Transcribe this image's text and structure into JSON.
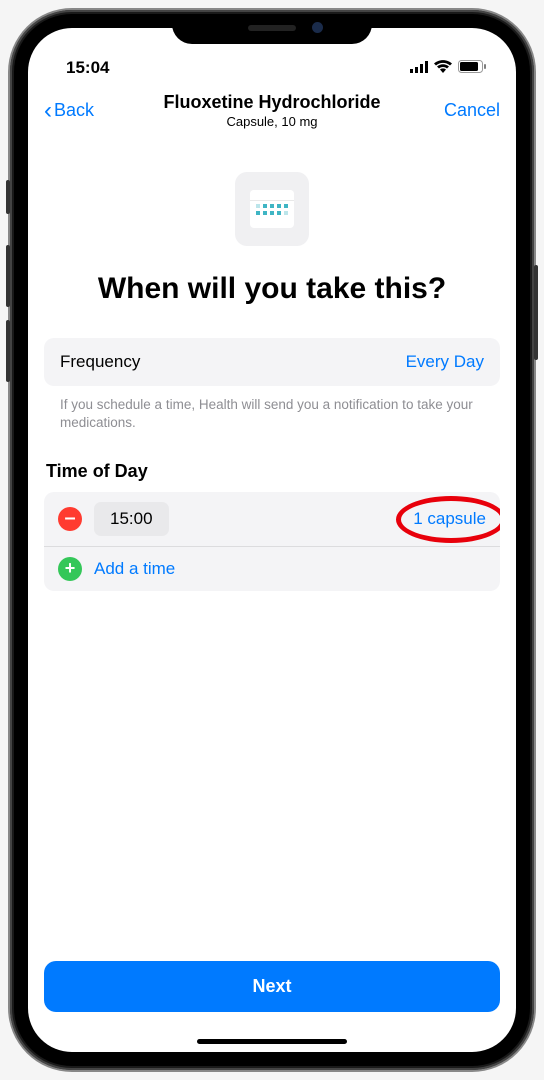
{
  "status": {
    "time": "15:04"
  },
  "nav": {
    "back": "Back",
    "title": "Fluoxetine Hydrochloride",
    "subtitle": "Capsule, 10 mg",
    "cancel": "Cancel"
  },
  "heading": "When will you take this?",
  "frequency": {
    "label": "Frequency",
    "value": "Every Day"
  },
  "hint": "If you schedule a time, Health will send you a notification to take your medications.",
  "time_of_day": {
    "label": "Time of Day",
    "entries": [
      {
        "time": "15:00",
        "dose": "1 capsule"
      }
    ],
    "add_label": "Add a time"
  },
  "next_button": "Next"
}
